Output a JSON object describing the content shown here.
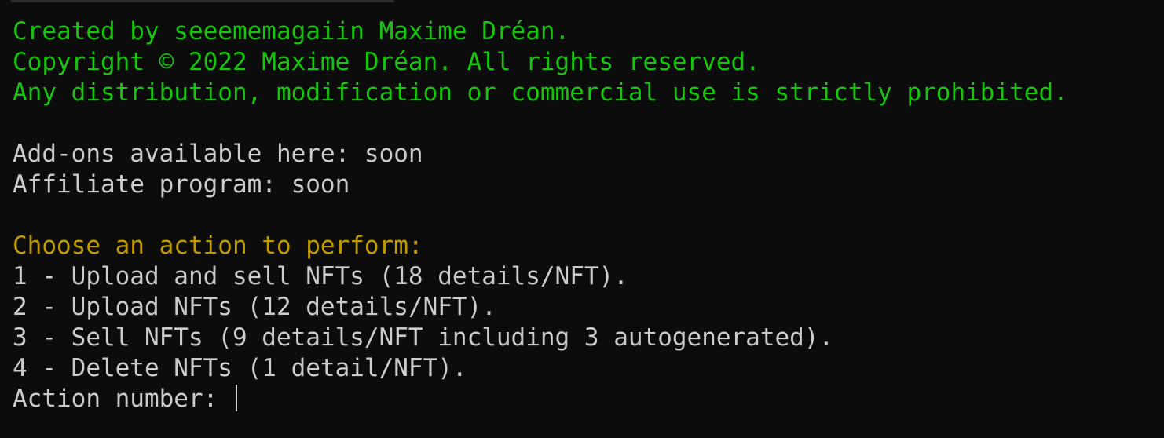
{
  "colors": {
    "green": "#16c60c",
    "gold": "#c19c00",
    "white": "#cccccc",
    "background": "#0c0c0c"
  },
  "header": {
    "line1": "Created by seeememagaiin Maxime Dréan.",
    "line2": "Copyright © 2022 Maxime Dréan. All rights reserved.",
    "line3": "Any distribution, modification or commercial use is strictly prohibited."
  },
  "info": {
    "addons": "Add-ons available here: soon",
    "affiliate": "Affiliate program: soon"
  },
  "menu": {
    "prompt": "Choose an action to perform:",
    "options": [
      "1 - Upload and sell NFTs (18 details/NFT).",
      "2 - Upload NFTs (12 details/NFT).",
      "3 - Sell NFTs (9 details/NFT including 3 autogenerated).",
      "4 - Delete NFTs (1 detail/NFT)."
    ],
    "input_label": "Action number: "
  }
}
